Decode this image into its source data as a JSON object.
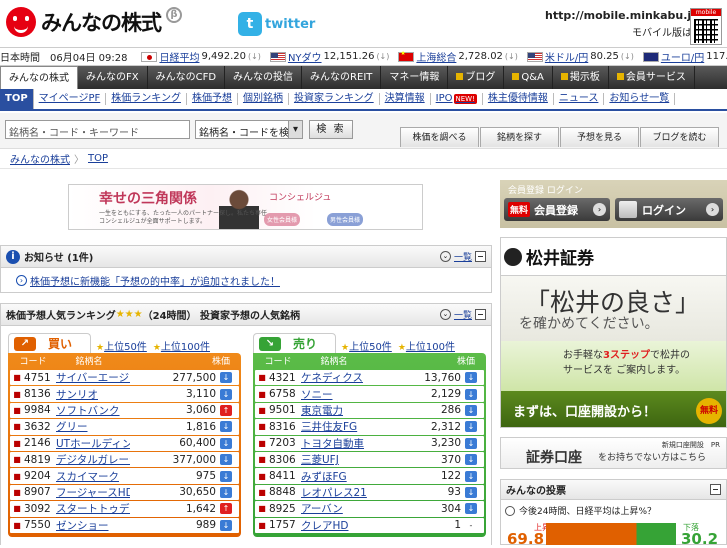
{
  "header": {
    "logo_text": "みんなの株式",
    "logo_beta": "β",
    "twitter_icon": "t",
    "twitter_text": "twitter",
    "mobile_url": "http://mobile.minkabu.jp",
    "mobile_sub": "モバイル版はこちら",
    "qr_label": "mobile"
  },
  "ticker": {
    "datetime": "日本時間　06月04日 09:28",
    "items": [
      {
        "flag": "jp",
        "label": "日経平均",
        "value": "9,492.20"
      },
      {
        "flag": "us",
        "label": "NYダウ",
        "value": "12,151.26"
      },
      {
        "flag": "cn",
        "label": "上海総合",
        "value": "2,728.02"
      },
      {
        "flag": "us",
        "label": "米ドル/円",
        "value": "80.25"
      },
      {
        "flag": "au",
        "label": "ユーロ/円",
        "value": "117.42"
      }
    ],
    "arrow": "(↓)"
  },
  "mainnav": [
    "みんなの株式",
    "みんなのFX",
    "みんなのCFD",
    "みんなの投信",
    "みんなのREIT",
    "マネー情報",
    "ブログ",
    "Q&A",
    "掲示板",
    "会員サービス"
  ],
  "subnav": [
    "TOP",
    "マイページPF",
    "株価ランキング",
    "株価予想",
    "個別銘柄",
    "投資家ランキング",
    "決算情報",
    "IPO",
    "株主優待情報",
    "ニュース",
    "お知らせ一覧"
  ],
  "subnav_new": "NEW!",
  "search": {
    "placeholder": "銘柄名・コード・キーワード",
    "select_value": "銘柄名・コードを検索",
    "button": "検 索",
    "side_tabs": [
      "株価を調べる",
      "銘柄を探す",
      "予想を見る",
      "ブログを読む"
    ]
  },
  "breadcrumb": {
    "home": "みんなの株式",
    "sep": "〉",
    "current": "TOP"
  },
  "banner": {
    "title": "幸せの三角関係",
    "subtitle": "コンシェルジュ",
    "text": "一生をともにする、たった一人のパートナー探し。私たち専任コンシェルジュが全面サポートします。",
    "badge1": "女性会員様",
    "badge2": "男性会員様"
  },
  "notice": {
    "title": "お知らせ (1件)",
    "more": "一覧",
    "item": "株価予想に新機能「予想の的中率」が追加されました！"
  },
  "ranking": {
    "title": "株価予想人気ランキング",
    "stars": "★★★",
    "subtitle": "（24時間） 投資家予想の人気銘柄",
    "more": "一覧",
    "buy": {
      "label": "買い",
      "icon": "↗",
      "links": [
        "上位50件",
        "上位100件"
      ],
      "headers": [
        "コード",
        "銘柄名",
        "株価"
      ],
      "rows": [
        {
          "code": "4751",
          "name": "サイバーエージェント",
          "price": "277,500",
          "dir": "down"
        },
        {
          "code": "8136",
          "name": "サンリオ",
          "price": "3,110",
          "dir": "down"
        },
        {
          "code": "9984",
          "name": "ソフトバンク",
          "price": "3,060",
          "dir": "up"
        },
        {
          "code": "3632",
          "name": "グリー",
          "price": "1,816",
          "dir": "down"
        },
        {
          "code": "2146",
          "name": "UTホールディングス",
          "price": "60,400",
          "dir": "down"
        },
        {
          "code": "4819",
          "name": "デジタルガレージ",
          "price": "377,000",
          "dir": "down"
        },
        {
          "code": "9204",
          "name": "スカイマーク",
          "price": "975",
          "dir": "down"
        },
        {
          "code": "8907",
          "name": "フージャースHD",
          "price": "30,650",
          "dir": "down"
        },
        {
          "code": "3092",
          "name": "スタートトゥデイ",
          "price": "1,642",
          "dir": "up"
        },
        {
          "code": "7550",
          "name": "ゼンショー",
          "price": "989",
          "dir": "down"
        }
      ]
    },
    "sell": {
      "label": "売り",
      "icon": "↘",
      "links": [
        "上位50件",
        "上位100件"
      ],
      "headers": [
        "コード",
        "銘柄名",
        "株価"
      ],
      "rows": [
        {
          "code": "4321",
          "name": "ケネディクス",
          "price": "13,760",
          "dir": "down"
        },
        {
          "code": "6758",
          "name": "ソニー",
          "price": "2,129",
          "dir": "down"
        },
        {
          "code": "9501",
          "name": "東京電力",
          "price": "286",
          "dir": "down"
        },
        {
          "code": "8316",
          "name": "三井住友FG",
          "price": "2,312",
          "dir": "down"
        },
        {
          "code": "7203",
          "name": "トヨタ自動車",
          "price": "3,230",
          "dir": "down"
        },
        {
          "code": "8306",
          "name": "三菱UFJ",
          "price": "370",
          "dir": "down"
        },
        {
          "code": "8411",
          "name": "みずほFG",
          "price": "122",
          "dir": "down"
        },
        {
          "code": "8848",
          "name": "レオパレス21",
          "price": "93",
          "dir": "down"
        },
        {
          "code": "8925",
          "name": "アーバン",
          "price": "304",
          "dir": "down"
        },
        {
          "code": "1757",
          "name": "クレアHD",
          "price": "1",
          "dir": "flat"
        }
      ]
    }
  },
  "member": {
    "title": "会員登録 ログイン",
    "register_badge": "無料",
    "register": "会員登録",
    "login": "ログイン"
  },
  "ad": {
    "brand": "松井証券",
    "headline": "「松井の良さ」",
    "subline": "を確かめてください。",
    "line1_pre": "お手軽な",
    "line1_em": "3ステップ",
    "line1_post": "で松井の",
    "line2": "サービスを ご案内します。",
    "bottom": "まずは、口座開設から！",
    "free": "無料"
  },
  "account": {
    "small": "新規口座開設　PR",
    "big": "証券口座",
    "sub": "をお持ちでない方はこちら"
  },
  "poll": {
    "title": "みんなの投票",
    "question": "今後24時間、日経平均は上昇%？",
    "left_label": "上昇",
    "left_value": "69.8",
    "left_percent": 69.8,
    "right_label": "下落",
    "right_value": "30.2",
    "right_percent": 30.2
  }
}
